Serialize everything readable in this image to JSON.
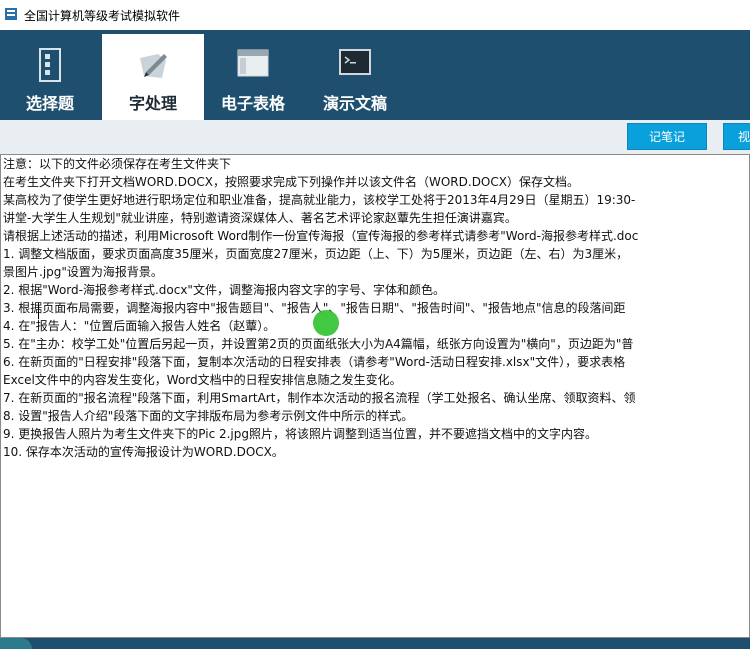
{
  "window": {
    "title": "全国计算机等级考试模拟软件"
  },
  "nav": {
    "tabs": [
      {
        "label": "选择题",
        "icon": "document-list-icon",
        "active": false
      },
      {
        "label": "字处理",
        "icon": "pen-edit-icon",
        "active": true
      },
      {
        "label": "电子表格",
        "icon": "spreadsheet-window-icon",
        "active": false
      },
      {
        "label": "演示文稿",
        "icon": "terminal-window-icon",
        "active": false
      }
    ]
  },
  "toolbar": {
    "notes_label": "记笔记",
    "next_label": "视"
  },
  "colors": {
    "nav_bg": "#1e4f6e",
    "button_bg": "#0aa0dc",
    "cursor": "#2ec22e"
  },
  "content": {
    "lines": [
      "       注意：以下的文件必须保存在考生文件夹下",
      "       在考生文件夹下打开文档WORD.DOCX，按照要求完成下列操作并以该文件名（WORD.DOCX）保存文档。",
      "       某高校为了使学生更好地进行职场定位和职业准备，提高就业能力，该校学工处将于2013年4月29日（星期五）19:30-",
      "讲堂-大学生人生规划\"就业讲座，特别邀请资深媒体人、著名艺术评论家赵蕈先生担任演讲嘉宾。",
      "       请根据上述活动的描述，利用Microsoft Word制作一份宣传海报（宣传海报的参考样式请参考\"Word-海报参考样式.doc",
      "       1. 调整文档版面，要求页面高度35厘米，页面宽度27厘米，页边距（上、下）为5厘米，页边距（左、右）为3厘米，",
      "景图片.jpg\"设置为海报背景。",
      "       2. 根据\"Word-海报参考样式.docx\"文件，调整海报内容文字的字号、字体和颜色。",
      "       3. 根据页面布局需要，调整海报内容中\"报告题目\"、\"报告人\"、\"报告日期\"、\"报告时间\"、\"报告地点\"信息的段落间距",
      "       4. 在\"报告人：\"位置后面输入报告人姓名（赵蕈）。",
      "       5. 在\"主办：校学工处\"位置后另起一页，并设置第2页的页面纸张大小为A4篇幅，纸张方向设置为\"横向\"，页边距为\"普",
      "       6. 在新页面的\"日程安排\"段落下面，复制本次活动的日程安排表（请参考\"Word-活动日程安排.xlsx\"文件），要求表格",
      "Excel文件中的内容发生变化，Word文档中的日程安排信息随之发生变化。",
      "       7. 在新页面的\"报名流程\"段落下面，利用SmartArt，制作本次活动的报名流程（学工处报名、确认坐席、领取资料、领",
      "       8. 设置\"报告人介绍\"段落下面的文字排版布局为参考示例文件中所示的样式。",
      "       9. 更换报告人照片为考生文件夹下的Pic 2.jpg照片，将该照片调整到适当位置，并不要遮挡文档中的文字内容。",
      "       10. 保存本次活动的宣传海报设计为WORD.DOCX。"
    ]
  }
}
